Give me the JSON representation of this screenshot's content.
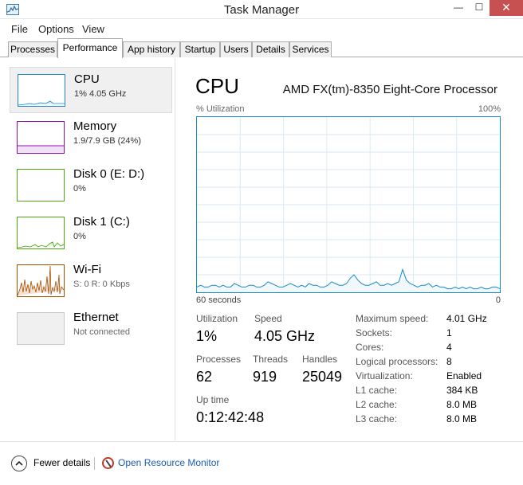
{
  "window": {
    "title": "Task Manager",
    "min_glyph": "—",
    "max_glyph": "☐",
    "close_glyph": "✕",
    "icon": "task-manager-icon"
  },
  "menu": [
    "File",
    "Options",
    "View"
  ],
  "tabs": [
    "Processes",
    "Performance",
    "App history",
    "Startup",
    "Users",
    "Details",
    "Services"
  ],
  "active_tab": "Performance",
  "sidebar": [
    {
      "name": "CPU",
      "sub": "1% 4.05 GHz",
      "color": "#1a89c7",
      "selected": true
    },
    {
      "name": "Memory",
      "sub": "1.9/7.9 GB (24%)",
      "color": "#8b12ae"
    },
    {
      "name": "Disk 0 (E: D:)",
      "sub": "0%",
      "color": "#4da60c"
    },
    {
      "name": "Disk 1 (C:)",
      "sub": "0%",
      "color": "#4da60c"
    },
    {
      "name": "Wi-Fi",
      "sub": "S: 0  R: 0 Kbps",
      "color": "#a74f01"
    },
    {
      "name": "Ethernet",
      "sub": "Not connected",
      "color": "#c8c8c8"
    }
  ],
  "main": {
    "title": "CPU",
    "processor": "AMD FX(tm)-8350 Eight-Core Processor",
    "util_label": "% Utilization",
    "util_max": "100%",
    "axis_left": "60 seconds",
    "axis_right": "0"
  },
  "stats": {
    "utilization_label": "Utilization",
    "utilization_value": "1%",
    "speed_label": "Speed",
    "speed_value": "4.05 GHz",
    "processes_label": "Processes",
    "processes_value": "62",
    "threads_label": "Threads",
    "threads_value": "919",
    "handles_label": "Handles",
    "handles_value": "25049",
    "uptime_label": "Up time",
    "uptime_value": "0:12:42:48"
  },
  "info": [
    {
      "label": "Maximum speed:",
      "value": "4.01 GHz"
    },
    {
      "label": "Sockets:",
      "value": "1"
    },
    {
      "label": "Cores:",
      "value": "4"
    },
    {
      "label": "Logical processors:",
      "value": "8"
    },
    {
      "label": "Virtualization:",
      "value": "Enabled"
    },
    {
      "label": "L1 cache:",
      "value": "384 KB"
    },
    {
      "label": "L2 cache:",
      "value": "8.0 MB"
    },
    {
      "label": "L3 cache:",
      "value": "8.0 MB"
    }
  ],
  "footer": {
    "fewer_details": "Fewer details",
    "open_resource_monitor": "Open Resource Monitor"
  },
  "cpu_history": [
    3,
    4,
    3,
    3,
    4,
    4,
    3,
    4,
    3,
    3,
    5,
    4,
    3,
    3,
    4,
    4,
    3,
    3,
    4,
    6,
    5,
    4,
    3,
    3,
    4,
    5,
    4,
    3,
    4,
    3,
    5,
    4,
    4,
    3,
    3,
    4,
    6,
    5,
    4,
    4,
    5,
    8,
    10,
    7,
    5,
    4,
    4,
    5,
    6,
    4,
    4,
    5,
    4,
    5,
    6,
    13,
    7,
    5,
    4,
    3,
    4,
    4,
    5,
    3,
    4,
    3,
    3,
    2,
    2,
    3,
    2,
    3,
    2,
    3,
    2,
    2,
    3,
    2,
    2,
    3,
    3,
    2
  ]
}
